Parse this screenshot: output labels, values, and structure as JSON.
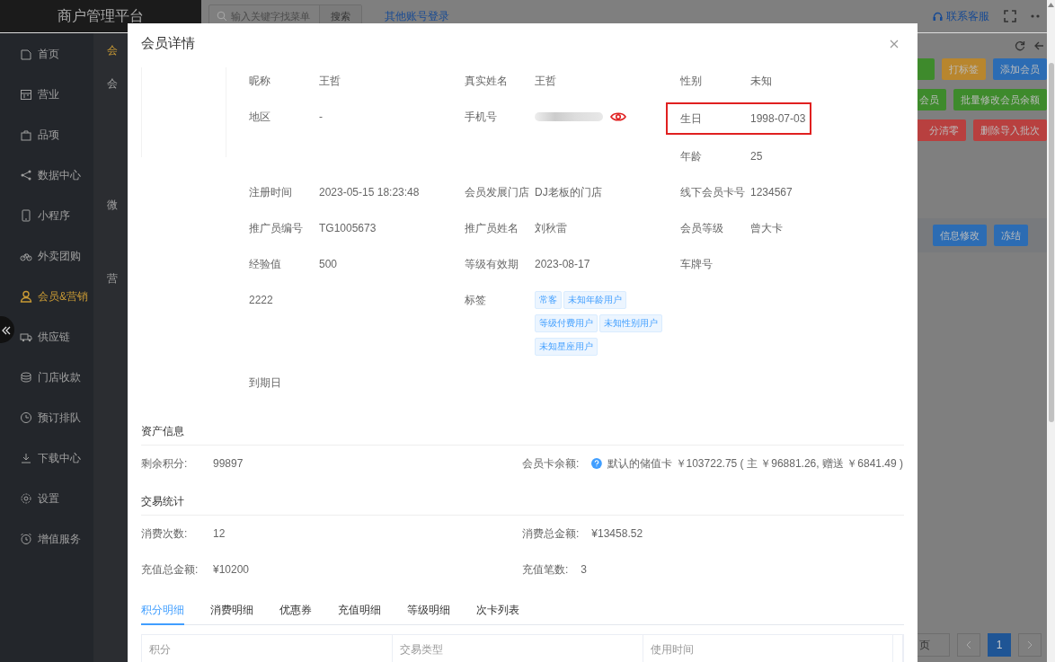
{
  "app": {
    "title": "商户管理平台",
    "search": {
      "placeholder": "输入关键字找菜单",
      "button": "搜索"
    },
    "other_login": "其他账号登录",
    "support": "联系客服"
  },
  "sidebar": {
    "items": [
      {
        "label": "首页",
        "selected": false
      },
      {
        "label": "营业",
        "selected": false
      },
      {
        "label": "品项",
        "selected": false
      },
      {
        "label": "数据中心",
        "selected": false
      },
      {
        "label": "小程序",
        "selected": false
      },
      {
        "label": "外卖团购",
        "selected": false
      },
      {
        "label": "会员&营销",
        "selected": true
      },
      {
        "label": "供应链",
        "selected": false
      },
      {
        "label": "门店收款",
        "selected": false
      },
      {
        "label": "预订排队",
        "selected": false
      },
      {
        "label": "下载中心",
        "selected": false
      },
      {
        "label": "设置",
        "selected": false
      },
      {
        "label": "增值服务",
        "selected": false
      }
    ]
  },
  "submenu": {
    "items": [
      {
        "label": "会",
        "selected": true
      },
      {
        "label": "会",
        "selected": false
      },
      {
        "label": "微",
        "selected": false
      },
      {
        "label": "营",
        "selected": false
      }
    ]
  },
  "toolbar_buttons": [
    [
      {
        "color": "#3e8a2c"
      },
      {
        "label": "打标签",
        "color": "#b8862e"
      },
      {
        "label": "添加会员",
        "color": "#2c6cb3"
      }
    ],
    [
      {
        "label": "会员",
        "color": "#3e8a2c"
      },
      {
        "label": "批量修改会员余额",
        "color": "#3e8a2c"
      }
    ],
    [
      {
        "label": "分清零",
        "color": "#b8403f"
      },
      {
        "label": "删除导入批次",
        "color": "#b8403f"
      }
    ]
  ],
  "row_buttons": [
    {
      "label": "信息修改",
      "color": "#2c6cb3"
    },
    {
      "label": "冻结",
      "color": "#2c6cb3"
    }
  ],
  "pagination": {
    "page_size": "页",
    "pages": [
      {
        "label": "1",
        "selected": true
      }
    ]
  },
  "modal": {
    "title": "会员详情",
    "profile_rows": [
      [
        {
          "kind": "text",
          "label": "昵称",
          "value": "王哲"
        },
        {
          "kind": "text",
          "label": "真实姓名",
          "value": "王哲"
        },
        {
          "kind": "text",
          "label": "性别",
          "value": "未知"
        }
      ],
      [
        {
          "kind": "text",
          "label": "地区",
          "value": "-"
        },
        {
          "kind": "masked",
          "label": "手机号"
        },
        {
          "kind": "text",
          "label": "生日",
          "value": "1998-07-03",
          "highlighted": true
        }
      ],
      [
        {
          "kind": "empty"
        },
        {
          "kind": "empty"
        },
        {
          "kind": "text",
          "label": "年龄",
          "value": "25"
        }
      ],
      [
        {
          "kind": "text",
          "label": "注册时间",
          "value": "2023-05-15 18:23:48"
        },
        {
          "kind": "text",
          "label": "会员发展门店",
          "value": "DJ老板的门店"
        },
        {
          "kind": "text",
          "label": "线下会员卡号",
          "value": "1234567"
        }
      ],
      [
        {
          "kind": "text",
          "label": "推广员编号",
          "value": "TG1005673"
        },
        {
          "kind": "text",
          "label": "推广员姓名",
          "value": "刘秋雷"
        },
        {
          "kind": "text",
          "label": "会员等级",
          "value": "曾大卡"
        }
      ],
      [
        {
          "kind": "text",
          "label": "经验值",
          "value": "500"
        },
        {
          "kind": "text",
          "label": "等级有效期",
          "value": "2023-08-17"
        },
        {
          "kind": "text",
          "label": "车牌号"
        }
      ],
      [
        {
          "kind": "text",
          "label": "2222"
        },
        {
          "kind": "tags",
          "label": "标签",
          "tags": [
            "常客",
            "未知年龄用户",
            "等级付费用户",
            "未知性别用户",
            "未知星座用户"
          ]
        },
        {
          "kind": "empty"
        }
      ],
      [
        {
          "kind": "text",
          "label": "到期日"
        }
      ]
    ],
    "sections": [
      {
        "title": "资产信息",
        "rows": [
          [
            {
              "label": "剩余积分:",
              "value": "99897"
            },
            {
              "label": "会员卡余额:",
              "help": true,
              "value": "默认的储值卡 ￥103722.75 ( 主 ￥96881.26, 赠送 ￥6841.49 )"
            }
          ]
        ]
      },
      {
        "title": "交易统计",
        "rows": [
          [
            {
              "label": "消费次数:",
              "value": "12"
            },
            {
              "label": "消费总金额:",
              "value": "¥13458.52"
            }
          ],
          [
            {
              "label": "充值总金额:",
              "value": "¥10200"
            },
            {
              "label": "充值笔数:",
              "value": "3"
            }
          ]
        ]
      }
    ],
    "tabs": [
      {
        "label": "积分明细",
        "selected": true
      },
      {
        "label": "消费明细",
        "selected": false
      },
      {
        "label": "优惠券",
        "selected": false
      },
      {
        "label": "充值明细",
        "selected": false
      },
      {
        "label": "等级明细",
        "selected": false
      },
      {
        "label": "次卡列表",
        "selected": false
      }
    ],
    "table": {
      "columns": [
        "积分",
        "交易类型",
        "使用时间"
      ]
    }
  }
}
